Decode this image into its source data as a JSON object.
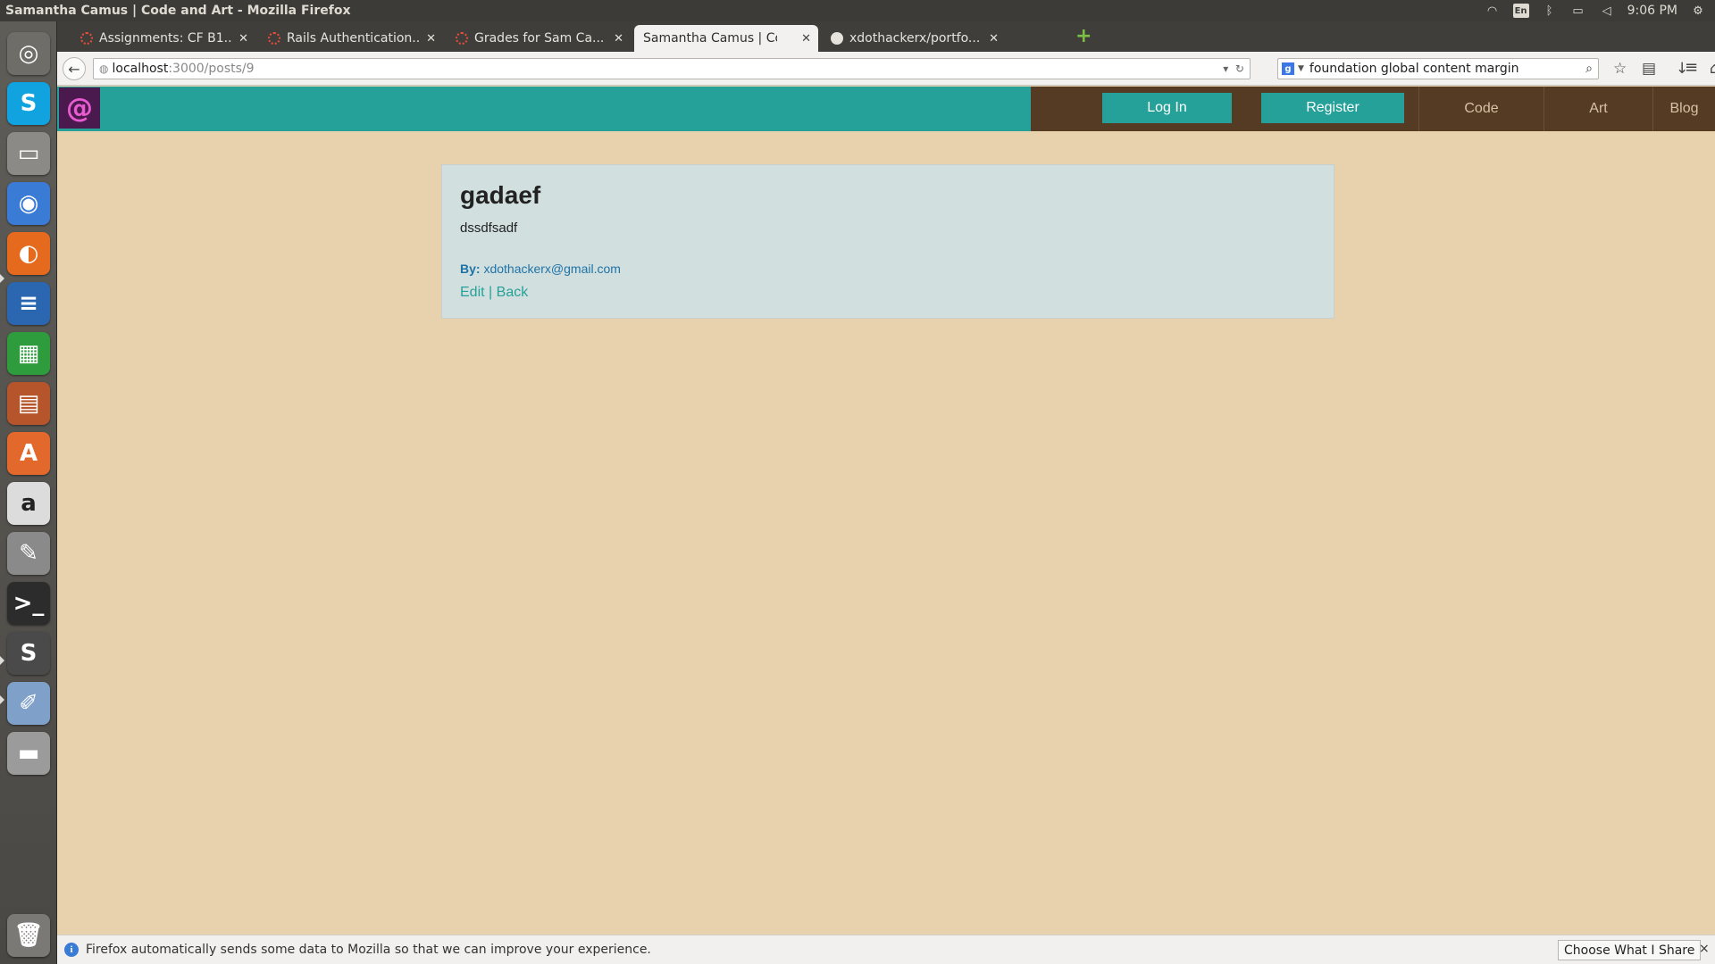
{
  "window": {
    "title": "Samantha Camus | Code and Art - Mozilla Firefox",
    "clock": "9:06 PM",
    "keyboard": "En"
  },
  "launcher": {
    "items": [
      {
        "name": "dash-home",
        "glyph": "◎",
        "color": "#6f6d68"
      },
      {
        "name": "skype",
        "glyph": "S",
        "color": "#10a3e0"
      },
      {
        "name": "files",
        "glyph": "▭",
        "color": "#8c8a86"
      },
      {
        "name": "chrome",
        "glyph": "◉",
        "color": "#3a7bd5"
      },
      {
        "name": "firefox",
        "glyph": "◐",
        "color": "#e66a1d"
      },
      {
        "name": "writer",
        "glyph": "≡",
        "color": "#2b67b1"
      },
      {
        "name": "calc",
        "glyph": "▦",
        "color": "#2e9b3d"
      },
      {
        "name": "impress",
        "glyph": "▤",
        "color": "#b6552b"
      },
      {
        "name": "software-center",
        "glyph": "A",
        "color": "#e2682b"
      },
      {
        "name": "amazon",
        "glyph": "a",
        "color": "#dcdcdc"
      },
      {
        "name": "system-settings",
        "glyph": "✎",
        "color": "#8a8a8a"
      },
      {
        "name": "terminal",
        "glyph": ">_",
        "color": "#2c2c2c"
      },
      {
        "name": "sublime-text",
        "glyph": "S",
        "color": "#4a4a4a"
      },
      {
        "name": "image-viewer",
        "glyph": "✐",
        "color": "#7fa0c9"
      },
      {
        "name": "drive",
        "glyph": "▬",
        "color": "#9b9b9b"
      },
      {
        "name": "trash",
        "glyph": "🗑",
        "color": "#7a7975"
      }
    ]
  },
  "tabs": [
    {
      "label": "Assignments: CF B1...",
      "active": false
    },
    {
      "label": "Rails Authentication...",
      "active": false
    },
    {
      "label": "Grades for Sam Ca...",
      "active": false
    },
    {
      "label": "Samantha Camus | Cod...",
      "active": true
    },
    {
      "label": "xdothackerx/portfo...",
      "active": false
    }
  ],
  "urlbar": {
    "host": "localhost",
    "path": ":3000/posts/9"
  },
  "searchbar": {
    "value": "foundation global content margin"
  },
  "site": {
    "nav": {
      "login": "Log In",
      "register": "Register",
      "code": "Code",
      "art": "Art",
      "blog": "Blog"
    },
    "post": {
      "title": "gadaef",
      "body": "dssdfsadf",
      "by_label": "By:",
      "author": "xdothackerx@gmail.com",
      "edit": "Edit",
      "separator": "|",
      "back": "Back"
    }
  },
  "notification": {
    "message": "Firefox automatically sends some data to Mozilla so that we can improve your experience.",
    "button": "Choose What I Share",
    "close": "×"
  },
  "colors": {
    "page_bg": "#e8d2ae",
    "header_teal": "#26a199",
    "nav_brown": "#553a24",
    "card_bg": "#d2dfdf",
    "logo_bg": "#4a1a4e"
  }
}
